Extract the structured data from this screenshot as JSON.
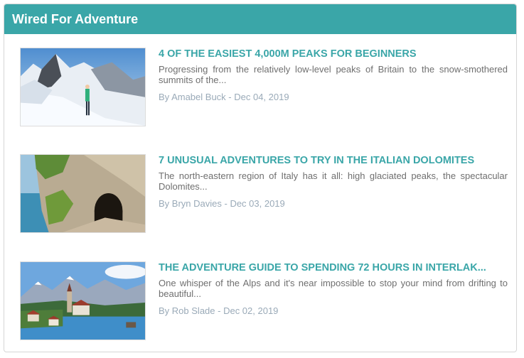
{
  "widget": {
    "title": "Wired For Adventure"
  },
  "articles": [
    {
      "title": "4 OF THE EASIEST 4,000M PEAKS FOR BEGINNERS",
      "excerpt": "Progressing from the relatively low-level peaks of Britain to the snow-smothered summits of the...",
      "meta_prefix": "By ",
      "author": "Amabel Buck",
      "separator": " - ",
      "date": "Dec 04, 2019",
      "image": "snowy-mountain-ridge-hiker"
    },
    {
      "title": "7 UNUSUAL ADVENTURES TO TRY IN THE ITALIAN DOLOMITES",
      "excerpt": "The north-eastern region of Italy has it all: high glaciated peaks, the spectacular Dolomites...",
      "meta_prefix": "By ",
      "author": "Bryn Davies",
      "separator": " - ",
      "date": "Dec 03, 2019",
      "image": "rock-tunnel-above-lake"
    },
    {
      "title": "THE ADVENTURE GUIDE TO SPENDING 72 HOURS IN INTERLAK...",
      "excerpt": "One whisper of the Alps and it's near impossible to stop your mind from drifting to beautiful...",
      "meta_prefix": "By ",
      "author": "Rob Slade",
      "separator": " - ",
      "date": "Dec 02, 2019",
      "image": "lakeside-village-alps"
    }
  ],
  "colors": {
    "accent": "#3aa6a8",
    "excerpt": "#6f6f6f",
    "meta": "#9aaab8"
  }
}
